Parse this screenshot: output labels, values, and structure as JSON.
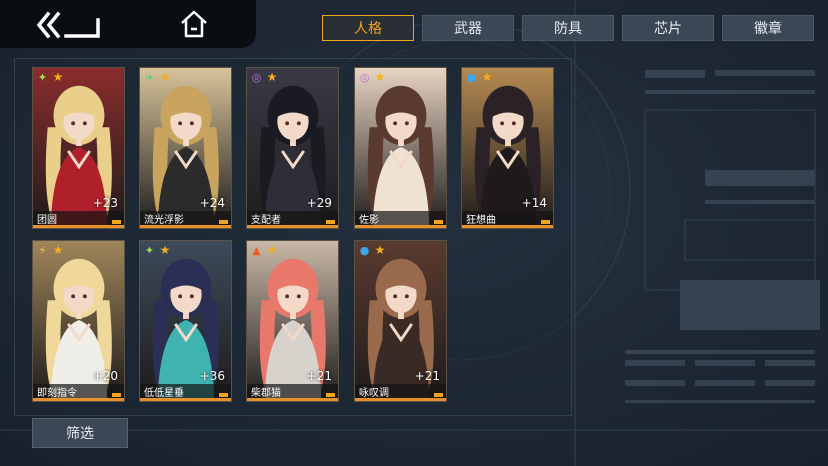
{
  "nav": {
    "back_icon": "double-chevron-back-icon",
    "home_icon": "home-icon"
  },
  "tabs": [
    {
      "label": "人格",
      "active": true
    },
    {
      "label": "武器",
      "active": false
    },
    {
      "label": "防具",
      "active": false
    },
    {
      "label": "芯片",
      "active": false
    },
    {
      "label": "徽章",
      "active": false
    }
  ],
  "characters": [
    {
      "name": "团圆",
      "level": "+23",
      "attr_icon": "sparkle-icon",
      "attr_color": "#9be35a",
      "bg": "#8a2c2c",
      "hair": "#e9cf8a",
      "outfit": "#b0202a"
    },
    {
      "name": "流光浮影",
      "level": "+24",
      "attr_icon": "leaf-icon",
      "attr_color": "#57d47a",
      "bg": "#d8c49a",
      "hair": "#c9a45f",
      "outfit": "#2b2b2b"
    },
    {
      "name": "支配者",
      "level": "+29",
      "attr_icon": "spiral-icon",
      "attr_color": "#c56be0",
      "bg": "#3a3a46",
      "hair": "#1a1a22",
      "outfit": "#2e2e38"
    },
    {
      "name": "佐影",
      "level": "",
      "attr_icon": "spiral-icon",
      "attr_color": "#c56be0",
      "bg": "#e8d4c2",
      "hair": "#5a3a2e",
      "outfit": "#f0e2d2"
    },
    {
      "name": "狂想曲",
      "level": "+14",
      "attr_icon": "water-drop-icon",
      "attr_color": "#3ba7e8",
      "bg": "#b58a52",
      "hair": "#2a2226",
      "outfit": "#1e1a1c"
    },
    {
      "name": "即刻指令",
      "level": "+20",
      "attr_icon": "lightning-icon",
      "attr_color": "#f2d22a",
      "bg": "#a0855a",
      "hair": "#efd89a",
      "outfit": "#f0eee8"
    },
    {
      "name": "低低星垂",
      "level": "+36",
      "attr_icon": "sparkle-icon",
      "attr_color": "#9be35a",
      "bg": "#3d4a5a",
      "hair": "#2b2f55",
      "outfit": "#3fb3b0"
    },
    {
      "name": "柴郡猫",
      "level": "+21",
      "attr_icon": "flame-icon",
      "attr_color": "#ee5a2a",
      "bg": "#c9b8a6",
      "hair": "#e8786a",
      "outfit": "#d8d2cc"
    },
    {
      "name": "咏叹调",
      "level": "+21",
      "attr_icon": "water-drop-icon",
      "attr_color": "#3ba7e8",
      "bg": "#5a3a2e",
      "hair": "#9a6a4c",
      "outfit": "#3a2a26"
    }
  ],
  "filter": {
    "label": "筛选"
  },
  "colors": {
    "accent": "#f2a41f",
    "star": "#f2b01e"
  }
}
